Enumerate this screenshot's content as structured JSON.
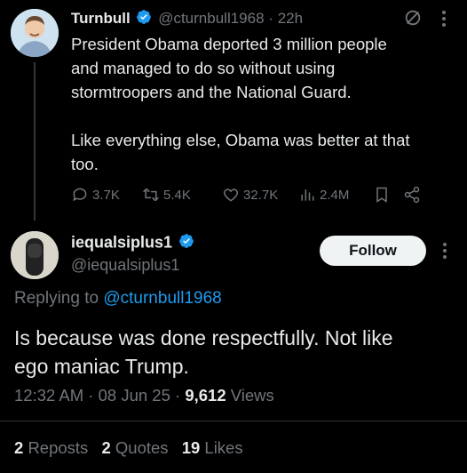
{
  "parent_tweet": {
    "display_name": "Turnbull",
    "handle": "@cturnbull1968",
    "separator": "·",
    "time_ago": "22h",
    "text_line1": "President Obama deported 3 million people",
    "text_line2": "and managed to do so without using",
    "text_line3": "stormtroopers and the National Guard.",
    "text_line4": "Like everything else, Obama was better at that",
    "text_line5": "too.",
    "metrics": {
      "replies": "3.7K",
      "reposts": "5.4K",
      "likes": "32.7K",
      "views": "2.4M"
    }
  },
  "reply_tweet": {
    "display_name": "iequalsiplus1",
    "handle": "@iequalsiplus1",
    "follow_label": "Follow",
    "replying_prefix": "Replying to",
    "replying_to": "@cturnbull1968",
    "text_line1": "Is because was done respectfully. Not like",
    "text_line2": "ego maniac Trump.",
    "timestamp": "12:32 AM · 08 Jun 25 · ",
    "views_count": "9,612",
    "views_label": " Views",
    "stats": {
      "reposts_count": "2",
      "reposts_label": "Reposts",
      "quotes_count": "2",
      "quotes_label": "Quotes",
      "likes_count": "19",
      "likes_label": "Likes"
    }
  },
  "colors": {
    "background": "#000000",
    "text": "#e7e9ea",
    "muted": "#71767b",
    "link": "#1d9bf0",
    "verified": "#1d9bf0"
  }
}
